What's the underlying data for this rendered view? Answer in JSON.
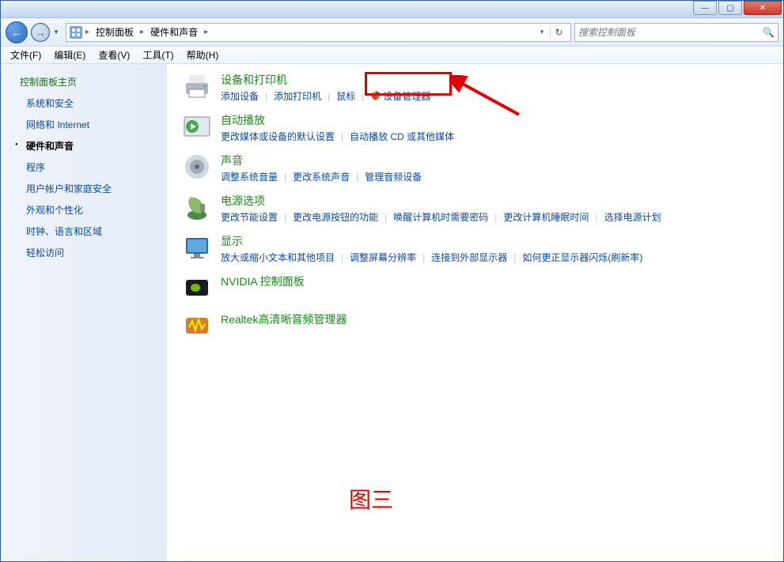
{
  "breadcrumb": {
    "item1": "控制面板",
    "item2": "硬件和声音"
  },
  "search": {
    "placeholder": "搜索控制面板"
  },
  "menu": {
    "file": "文件(F)",
    "edit": "编辑(E)",
    "view": "查看(V)",
    "tools": "工具(T)",
    "help": "帮助(H)"
  },
  "sidebar": {
    "heading": "控制面板主页",
    "items": [
      "系统和安全",
      "网络和 Internet",
      "硬件和声音",
      "程序",
      "用户帐户和家庭安全",
      "外观和个性化",
      "时钟、语言和区域",
      "轻松访问"
    ],
    "active_index": 2
  },
  "categories": [
    {
      "title": "设备和打印机",
      "links": [
        "添加设备",
        "添加打印机",
        "鼠标",
        "设备管理器"
      ],
      "shield_index": 3,
      "icon": "printer"
    },
    {
      "title": "自动播放",
      "links": [
        "更改媒体或设备的默认设置",
        "自动播放 CD 或其他媒体"
      ],
      "icon": "autoplay"
    },
    {
      "title": "声音",
      "links": [
        "调整系统音量",
        "更改系统声音",
        "管理音频设备"
      ],
      "icon": "sound"
    },
    {
      "title": "电源选项",
      "links": [
        "更改节能设置",
        "更改电源按钮的功能",
        "唤醒计算机时需要密码",
        "更改计算机睡眠时间",
        "选择电源计划"
      ],
      "icon": "power"
    },
    {
      "title": "显示",
      "links": [
        "放大或缩小文本和其他项目",
        "调整屏幕分辨率",
        "连接到外部显示器",
        "如何更正显示器闪烁(刷新率)"
      ],
      "icon": "display"
    },
    {
      "title": "NVIDIA 控制面板",
      "links": [],
      "icon": "nvidia"
    },
    {
      "title": "Realtek高清晰音频管理器",
      "links": [],
      "icon": "realtek"
    }
  ],
  "annotation": {
    "figure_label": "图三"
  }
}
